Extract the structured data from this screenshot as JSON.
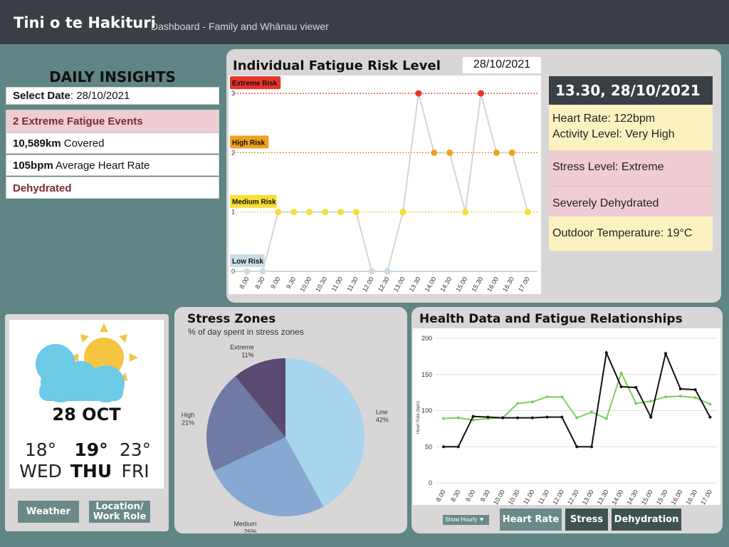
{
  "header": {
    "title": "Tini o te Hakituri",
    "subtitle": "Dashboard - Family and Whānau viewer"
  },
  "insights": {
    "title": "DAILY INSIGHTS",
    "select_date_label": "Select Date",
    "select_date_value": ": 28/10/2021",
    "events": "2 Extreme Fatigue Events",
    "distance_value": "10,589km",
    "distance_label": " Covered",
    "heart_rate_value": "105bpm",
    "heart_rate_label": " Average Heart Rate",
    "hydration": "Dehydrated"
  },
  "fatigue": {
    "title": "Individual Fatigue Risk Level",
    "date": "28/10/2021"
  },
  "detail": {
    "heading": "13.30, 28/10/2021",
    "heart_rate": "Heart Rate: 122bpm",
    "activity": "Activity Level: Very High",
    "stress": "Stress Level: Extreme",
    "hydration": "Severely Dehydrated",
    "temperature": "Outdoor Temperature: 19°C"
  },
  "weather": {
    "date": "28 OCT",
    "days": [
      {
        "temp": "18°",
        "day": "WED"
      },
      {
        "temp": "19°",
        "day": "THU"
      },
      {
        "temp": "23°",
        "day": "FRI"
      }
    ],
    "weather_button": "Weather",
    "location_button_line1": "Location/",
    "location_button_line2": "Work Role",
    "icon": "partly-cloudy-icon"
  },
  "stress": {
    "title": "Stress Zones",
    "subtitle": "% of day spent in stress zones"
  },
  "health": {
    "title": "Health Data and Fatigue Relationships",
    "show_hourly": "Show Hourly ▼",
    "buttons": [
      "Heart Rate",
      "Stress",
      "Dehydration"
    ]
  },
  "colors": {
    "extreme": "#e8332a",
    "high": "#f0a020",
    "medium": "#f7df33",
    "low": "#c9dde6",
    "heart_line": "#7bcf5a",
    "fatigue_line": "#111111"
  },
  "chart_data": [
    {
      "type": "line",
      "title": "Individual Fatigue Risk Level",
      "x": [
        "8.00",
        "8.30",
        "9.00",
        "9.30",
        "10.00",
        "10.30",
        "11.00",
        "11.30",
        "12.00",
        "12.30",
        "13.00",
        "13.30",
        "14.00",
        "14.30",
        "15.00",
        "15.30",
        "16.00",
        "16.30",
        "17.00"
      ],
      "values": [
        0,
        0,
        1,
        1,
        1,
        1,
        1,
        1,
        0,
        0,
        1,
        3,
        2,
        2,
        1,
        3,
        2,
        2,
        1
      ],
      "ylim": [
        0,
        3
      ],
      "yticks": [
        0,
        1,
        2,
        3
      ],
      "levels": [
        {
          "value": 3,
          "label": "Extreme Risk"
        },
        {
          "value": 2,
          "label": "High Risk"
        },
        {
          "value": 1,
          "label": "Medium Risk"
        },
        {
          "value": 0,
          "label": "Low Risk"
        }
      ]
    },
    {
      "type": "pie",
      "title": "Stress Zones",
      "slices": [
        {
          "name": "Low",
          "value": 42,
          "label": "42%",
          "color": "#a8d4ee"
        },
        {
          "name": "Medium",
          "value": 26,
          "label": "26%",
          "color": "#87a8d0"
        },
        {
          "name": "High",
          "value": 21,
          "label": "21%",
          "color": "#6f7aa5"
        },
        {
          "name": "Extreme",
          "value": 11,
          "label": "11%",
          "color": "#5a4a72"
        }
      ]
    },
    {
      "type": "line",
      "title": "Health Data and Fatigue Relationships",
      "x": [
        "8.00",
        "8.30",
        "9.00",
        "9.30",
        "10.00",
        "10.30",
        "11.00",
        "11.30",
        "12.00",
        "12.30",
        "13.00",
        "13.30",
        "14.00",
        "14.30",
        "15.00",
        "15.30",
        "16.00",
        "16.30",
        "17.00"
      ],
      "ylabel": "Heart Rate (bpm)",
      "ylim": [
        0,
        200
      ],
      "yticks": [
        0,
        50,
        100,
        150,
        200
      ],
      "series": [
        {
          "values": [
            89,
            90,
            87,
            89,
            90,
            110,
            112,
            119,
            119,
            90,
            98,
            89,
            152,
            110,
            113,
            119,
            120,
            118,
            109
          ]
        },
        {
          "values": [
            50,
            50,
            92,
            91,
            90,
            90,
            90,
            91,
            91,
            50,
            50,
            180,
            133,
            132,
            91,
            179,
            130,
            129,
            91
          ]
        }
      ]
    }
  ]
}
